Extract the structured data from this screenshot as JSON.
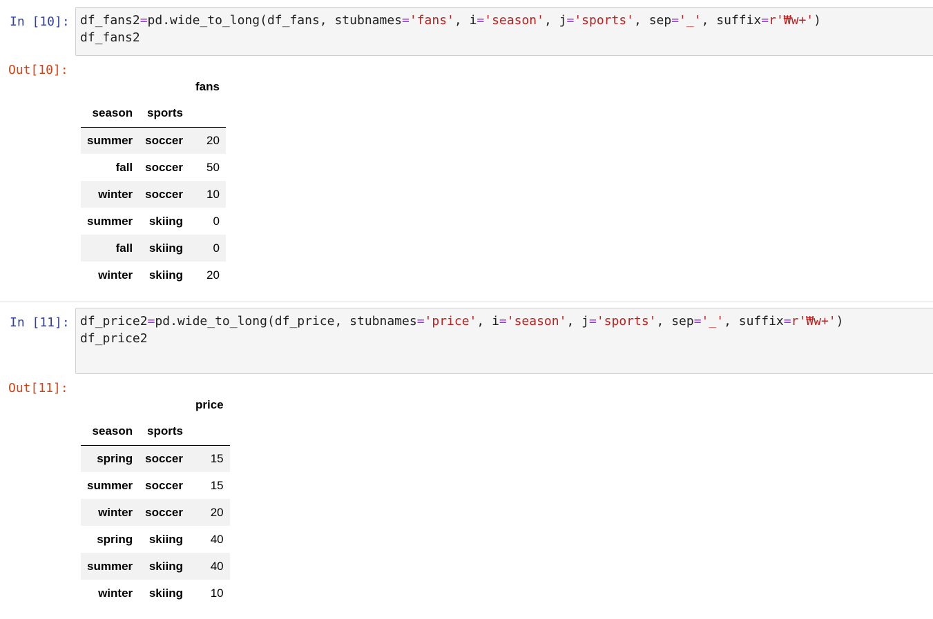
{
  "cells": [
    {
      "in_prompt": "In [10]:",
      "out_prompt": "Out[10]:",
      "code_lines": [
        [
          {
            "t": "df_fans2"
          },
          {
            "t": "=",
            "k": "op"
          },
          {
            "t": "pd.wide_to_long(df_fans, stubnames"
          },
          {
            "t": "=",
            "k": "op"
          },
          {
            "t": "'fans'",
            "k": "str"
          },
          {
            "t": ", i"
          },
          {
            "t": "=",
            "k": "op"
          },
          {
            "t": "'season'",
            "k": "str"
          },
          {
            "t": ", j"
          },
          {
            "t": "=",
            "k": "op"
          },
          {
            "t": "'sports'",
            "k": "str"
          },
          {
            "t": ", sep"
          },
          {
            "t": "=",
            "k": "op"
          },
          {
            "t": "'_'",
            "k": "str"
          },
          {
            "t": ", suffix"
          },
          {
            "t": "=",
            "k": "op"
          },
          {
            "t": "r'₩w+'",
            "k": "str"
          },
          {
            "t": ")"
          }
        ],
        [
          {
            "t": "df_fans2"
          }
        ]
      ],
      "table": {
        "value_column": "fans",
        "index_names": [
          "season",
          "sports"
        ],
        "rows": [
          {
            "season": "summer",
            "sports": "soccer",
            "value": "20"
          },
          {
            "season": "fall",
            "sports": "soccer",
            "value": "50"
          },
          {
            "season": "winter",
            "sports": "soccer",
            "value": "10"
          },
          {
            "season": "summer",
            "sports": "skiing",
            "value": "0"
          },
          {
            "season": "fall",
            "sports": "skiing",
            "value": "0"
          },
          {
            "season": "winter",
            "sports": "skiing",
            "value": "20"
          }
        ]
      }
    },
    {
      "in_prompt": "In [11]:",
      "out_prompt": "Out[11]:",
      "code_lines": [
        [
          {
            "t": "df_price2"
          },
          {
            "t": "=",
            "k": "op"
          },
          {
            "t": "pd.wide_to_long(df_price, stubnames"
          },
          {
            "t": "=",
            "k": "op"
          },
          {
            "t": "'price'",
            "k": "str"
          },
          {
            "t": ", i"
          },
          {
            "t": "=",
            "k": "op"
          },
          {
            "t": "'season'",
            "k": "str"
          },
          {
            "t": ", j"
          },
          {
            "t": "=",
            "k": "op"
          },
          {
            "t": "'sports'",
            "k": "str"
          },
          {
            "t": ", sep"
          },
          {
            "t": "=",
            "k": "op"
          },
          {
            "t": "'_'",
            "k": "str"
          },
          {
            "t": ", suffix"
          },
          {
            "t": "=",
            "k": "op"
          },
          {
            "t": "r'₩w+'",
            "k": "str"
          },
          {
            "t": ")"
          }
        ],
        [
          {
            "t": "df_price2"
          }
        ]
      ],
      "table": {
        "value_column": "price",
        "index_names": [
          "season",
          "sports"
        ],
        "rows": [
          {
            "season": "spring",
            "sports": "soccer",
            "value": "15"
          },
          {
            "season": "summer",
            "sports": "soccer",
            "value": "15"
          },
          {
            "season": "winter",
            "sports": "soccer",
            "value": "20"
          },
          {
            "season": "spring",
            "sports": "skiing",
            "value": "40"
          },
          {
            "season": "summer",
            "sports": "skiing",
            "value": "40"
          },
          {
            "season": "winter",
            "sports": "skiing",
            "value": "10"
          }
        ]
      }
    }
  ]
}
